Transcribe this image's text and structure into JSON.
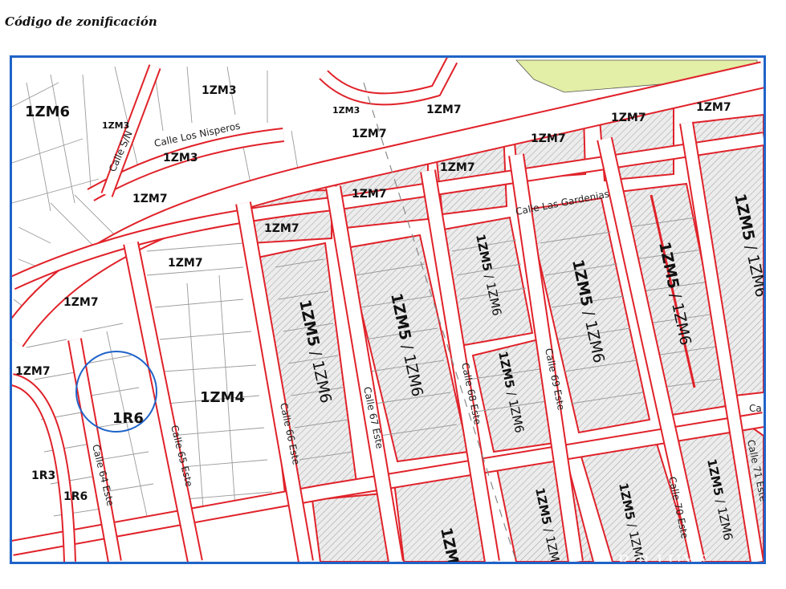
{
  "title": "Código de zonificación",
  "colors": {
    "frame": "#1f63c8",
    "zone_border": "#e0222a",
    "road_fill": "#ffffff",
    "hatched_fill": "#e4e4e4",
    "green_area": "#e3eea6",
    "highlight_circle": "#1f63c8"
  },
  "watermark": "R B LUXE",
  "streets": {
    "los_nisperos": "Calle Los Nisperos",
    "s_n": "Calle S/N",
    "las_gardenias": "Calle Las Gardenias",
    "c64": "Calle 64 Este",
    "c65": "Calle 65 Este",
    "c66": "Calle 66 Este",
    "c67": "Calle 67 Este",
    "c68": "Calle 68 Este",
    "c69": "Calle 69 Este",
    "c70": "Calle 70 Este",
    "c71": "Calle 71 Este",
    "c71_partial": "Ca"
  },
  "zones": {
    "zm6_a": "1ZM6",
    "zm3_a": "1ZM3",
    "zm3_b": "1ZM3",
    "zm3_c": "1ZM3",
    "zm3_d": "1ZM3",
    "zm7_a": "1ZM7",
    "zm7_b": "1ZM7",
    "zm7_c": "1ZM7",
    "zm7_d": "1ZM7",
    "zm7_e": "1ZM7",
    "zm7_f": "1ZM7",
    "zm7_g": "1ZM7",
    "zm7_h": "1ZM7",
    "zm7_i": "1ZM7",
    "zm7_j": "1ZM7",
    "zm7_k": "1ZM7",
    "zm7_l": "1ZM7",
    "zm7_m": "1ZM7",
    "zm4": "1ZM4",
    "r6_main": "1R6",
    "r6_b": "1R6",
    "r3": "1R3",
    "zm5": "1ZM5",
    "zm6": "1ZM6",
    "sep": " / ",
    "zm_cut": "1ZM"
  }
}
